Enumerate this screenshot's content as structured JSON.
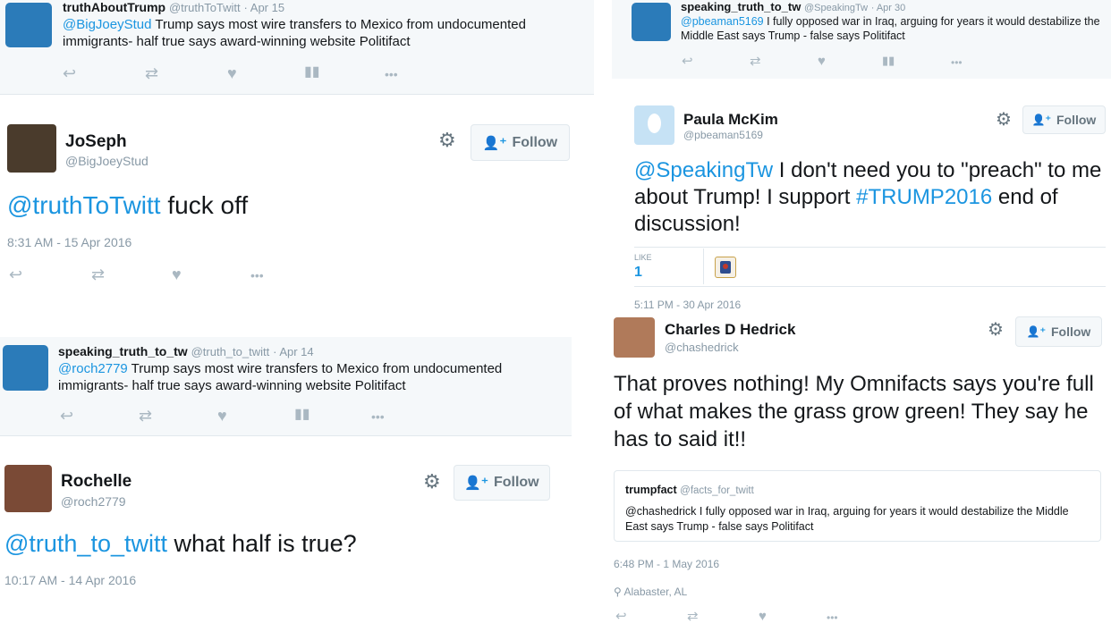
{
  "t1": {
    "name": "truthAboutTrump",
    "handle": "@truthToTwitt",
    "date": "· Apr 15",
    "mention": "@BigJoeyStud",
    "text": " Trump says most wire transfers to Mexico from undocumented immigrants- half true says award-winning website Politifact"
  },
  "t2": {
    "name": "JoSeph",
    "handle": "@BigJoeyStud",
    "follow": "Follow",
    "mention": "@truthToTwitt",
    "text": " fuck off",
    "timestamp": "8:31 AM - 15 Apr 2016"
  },
  "t3": {
    "name": "speaking_truth_to_tw",
    "handle": "@truth_to_twitt",
    "date": "· Apr 14",
    "mention": "@roch2779",
    "text": " Trump says most wire transfers to Mexico from undocumented immigrants- half true says award-winning website Politifact"
  },
  "t4": {
    "name": "Rochelle",
    "handle": "@roch2779",
    "follow": "Follow",
    "mention": "@truth_to_twitt",
    "text": " what half is true?",
    "timestamp": "10:17 AM - 14 Apr 2016"
  },
  "t5": {
    "name": "speaking_truth_to_tw",
    "handle": "@SpeakingTw",
    "date": "· Apr 30",
    "mention": "@pbeaman5169",
    "text": " I fully opposed war in Iraq, arguing for years it would destabilize the Middle East says Trump - false says Politifact"
  },
  "t6": {
    "name": "Paula McKim",
    "handle": "@pbeaman5169",
    "follow": "Follow",
    "mention": "@SpeakingTw",
    "text1": " I don't need you to \"preach\" to me about Trump! I support ",
    "hashtag": "#TRUMP2016",
    "text2": " end of discussion!",
    "likes_label": "LIKE",
    "likes_count": "1",
    "timestamp": "5:11 PM - 30 Apr 2016"
  },
  "t7": {
    "name": "Charles D Hedrick",
    "handle": "@chashedrick",
    "follow": "Follow",
    "text": "That proves nothing! My Omnifacts says you're full of what makes the grass grow green! They say he has to said it!!",
    "quote_name": "trumpfact",
    "quote_handle": "@facts_for_twitt",
    "quote_text": "@chashedrick I fully opposed war in Iraq, arguing for years it would destabilize the Middle East says Trump - false says Politifact",
    "timestamp": "6:48 PM - 1 May 2016",
    "location": "Alabaster, AL"
  },
  "icons": {
    "reply": "↩",
    "retweet": "⇄",
    "like": "♥",
    "analytics": "📊",
    "more": "•••",
    "gear": "⚙",
    "add-user": "👤+",
    "pin": "📍"
  },
  "colors": {
    "link": "#1b95e0",
    "muted": "#8899a6",
    "shade": "#f5f8fa"
  }
}
